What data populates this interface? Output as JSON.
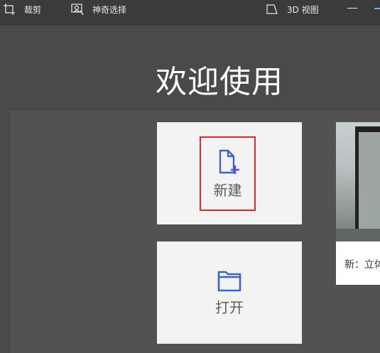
{
  "toolbar": {
    "crop_label": "裁剪",
    "magic_select_label": "神奇选择",
    "view3d_label": "3D 视图"
  },
  "welcome": {
    "title": "欢迎使用"
  },
  "tiles": {
    "new_label": "新建",
    "open_label": "打开"
  },
  "promo": {
    "caption": "新：立体"
  },
  "colors": {
    "app_bg": "#4a4a4a",
    "tile_bg": "#f3f3f3",
    "accent_blue": "#3b63d4",
    "focus_red": "#e0282a"
  },
  "icons": {
    "crop": "crop-icon",
    "magic_select": "magic-select-icon",
    "view3d": "view-3d-icon",
    "new": "new-file-icon",
    "open": "folder-icon"
  }
}
